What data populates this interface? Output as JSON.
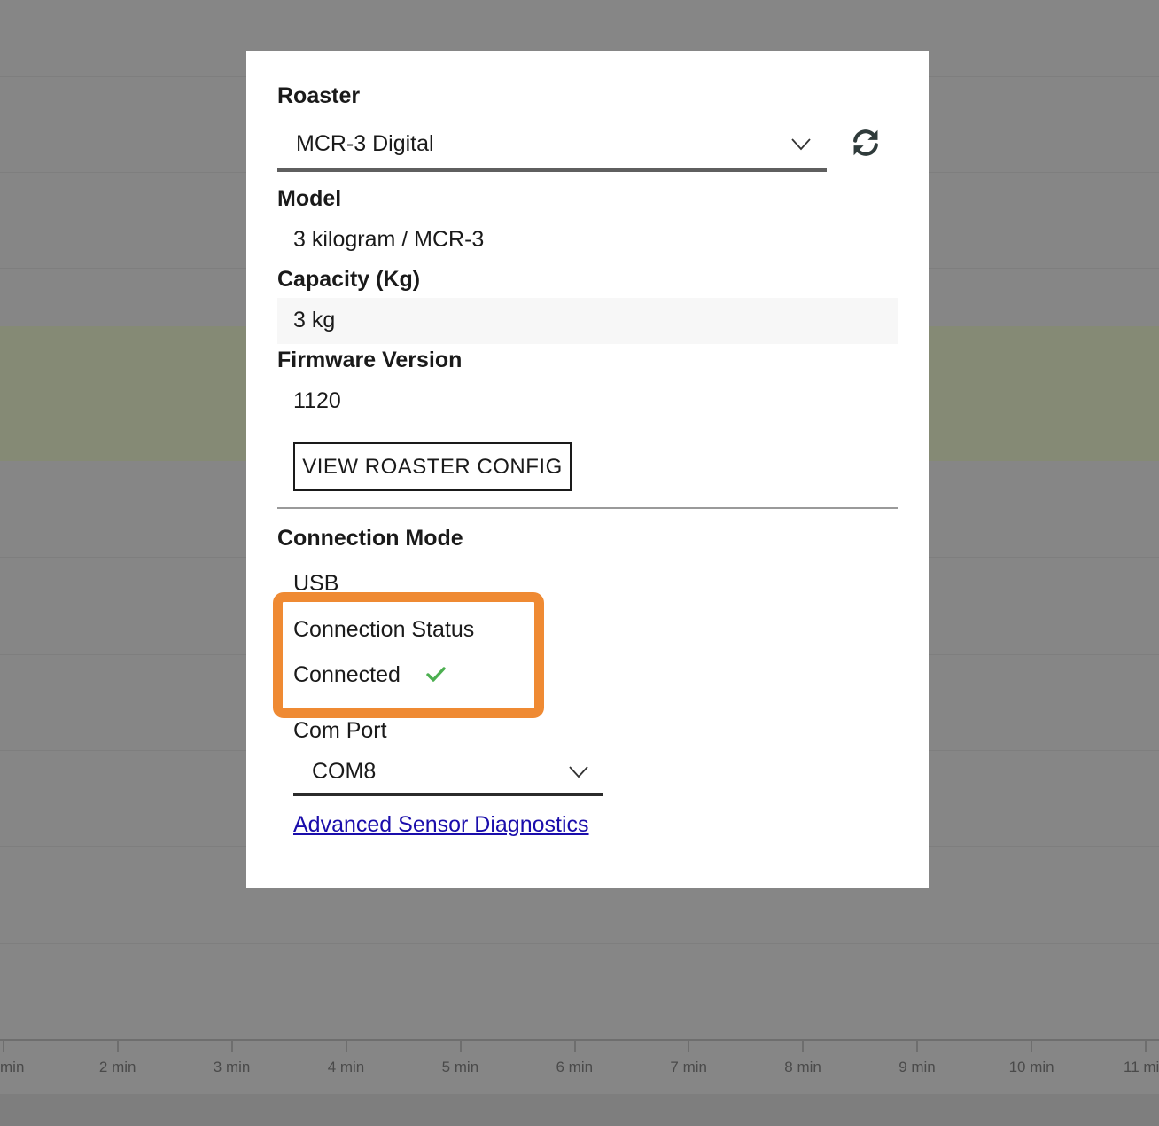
{
  "modal": {
    "roaster_label": "Roaster",
    "roaster_select_value": "MCR-3 Digital",
    "model_label": "Model",
    "model_value": "3 kilogram / MCR-3",
    "capacity_label": "Capacity (Kg)",
    "capacity_value": "3 kg",
    "firmware_label": "Firmware Version",
    "firmware_value": "1120",
    "view_config_button": "VIEW ROASTER CONFIG",
    "connection_mode_label": "Connection Mode",
    "connection_mode_value": "USB",
    "connection_status_label": "Connection Status",
    "connection_status_value": "Connected",
    "com_port_label": "Com Port",
    "com_port_value": "COM8",
    "advanced_link": "Advanced Sensor Diagnostics"
  },
  "background_axis": {
    "tick_labels": [
      "min",
      "2 min",
      "3 min",
      "4 min",
      "5 min",
      "6 min",
      "7 min",
      "8 min",
      "9 min",
      "10 min",
      "11 mi"
    ]
  },
  "colors": {
    "highlight": "#ef8a33",
    "check": "#4caf50",
    "link": "#1a0dab"
  },
  "icons": {
    "refresh": "refresh-icon",
    "dropdown": "chevron-down-icon",
    "status_ok": "check-icon"
  }
}
